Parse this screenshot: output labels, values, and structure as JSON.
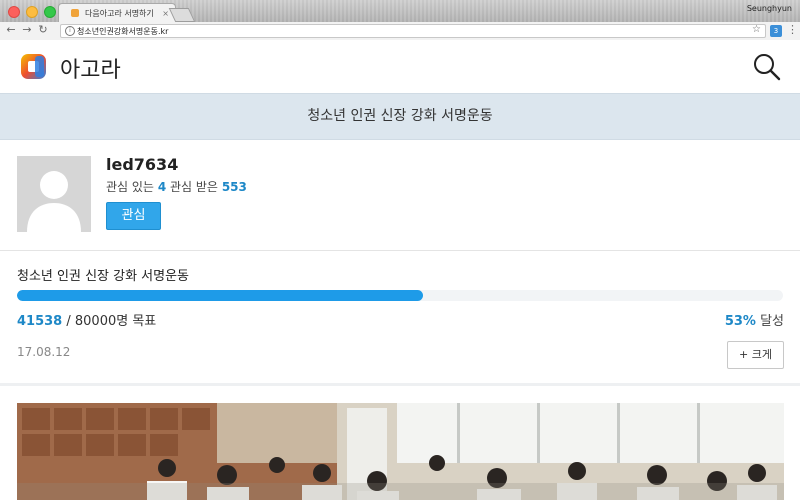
{
  "browser": {
    "tab_title": "다음아고라 서명하기",
    "tab_close": "×",
    "user": "Seunghyun",
    "url": "청소년인권강화서명운동.kr",
    "ext_badge": "3"
  },
  "header": {
    "brand": "아고라",
    "icons": [
      "agora-logo-icon",
      "search-icon"
    ]
  },
  "banner": {
    "title": "청소년 인권 신장 강화 서명운동"
  },
  "profile": {
    "username": "led7634",
    "interest_label": "관심 있는",
    "interest_count": "4",
    "received_label": "관심 받은",
    "received_count": "553",
    "follow_label": "관심"
  },
  "petition": {
    "title": "청소년 인권 신장 강화 서명운동",
    "signatures": "41538",
    "goal_text": "/ 80000명 목표",
    "percent": "53%",
    "percent_label": "달성",
    "progress_fraction": 0.53,
    "date": "17.08.12",
    "zoom_label": "+ 크게"
  },
  "colors": {
    "accent": "#1e9be8",
    "button": "#31a6ea",
    "banner_bg": "#dce6ee",
    "number": "#1e88c7"
  }
}
